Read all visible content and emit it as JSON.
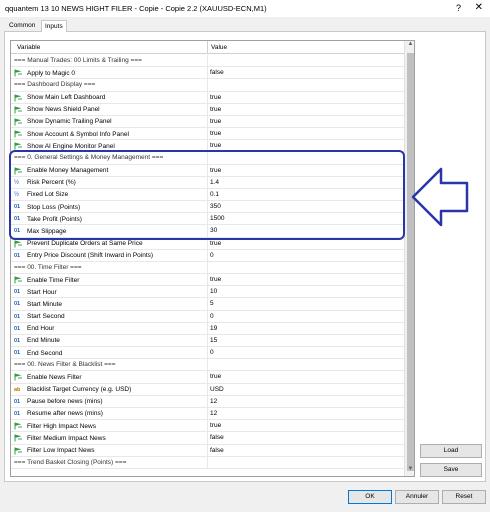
{
  "window": {
    "title": "qquantem 13 10 NEWS HIGHT FILER - Copie - Copie 2.2 (XAUUSD-ECN,M1)",
    "help": "?",
    "close": "✕"
  },
  "tabs": [
    {
      "label": "Common"
    },
    {
      "label": "Inputs"
    }
  ],
  "grid": {
    "col_variable": "Variable",
    "col_value": "Value",
    "rows": [
      {
        "icon": "",
        "name": "=== Manual Trades: 00 Limits & Trailing ===",
        "value": ""
      },
      {
        "icon": "flag",
        "name": "Apply to Magic 0",
        "value": "false"
      },
      {
        "icon": "",
        "name": "=== Dashboard Display ===",
        "value": ""
      },
      {
        "icon": "flag",
        "name": "Show Main Left Dashboard",
        "value": "true"
      },
      {
        "icon": "flag",
        "name": "Show News Shield Panel",
        "value": "true"
      },
      {
        "icon": "flag",
        "name": "Show Dynamic Trailing Panel",
        "value": "true"
      },
      {
        "icon": "flag",
        "name": "Show Account & Symbol Info Panel",
        "value": "true"
      },
      {
        "icon": "flag",
        "name": "Show AI Engine Monitor Panel",
        "value": "true"
      },
      {
        "icon": "",
        "name": "=== 0. General Settings & Money Management ===",
        "value": ""
      },
      {
        "icon": "flag",
        "name": "Enable Money Management",
        "value": "true"
      },
      {
        "icon": "frac",
        "name": "Risk Percent (%)",
        "value": "1.4"
      },
      {
        "icon": "frac",
        "name": "Fixed Lot Size",
        "value": "0.1"
      },
      {
        "icon": "num",
        "name": "Stop Loss (Points)",
        "value": "350"
      },
      {
        "icon": "num",
        "name": "Take Profit (Points)",
        "value": "1500"
      },
      {
        "icon": "num",
        "name": "Max Slippage",
        "value": "30"
      },
      {
        "icon": "flag",
        "name": "Prevent Duplicate Orders at Same Price",
        "value": "true"
      },
      {
        "icon": "num",
        "name": "Entry Price Discount (Shift Inward in Points)",
        "value": "0"
      },
      {
        "icon": "",
        "name": "=== 00. Time Filter ===",
        "value": ""
      },
      {
        "icon": "flag",
        "name": "Enable Time Filter",
        "value": "true"
      },
      {
        "icon": "num",
        "name": "Start Hour",
        "value": "10"
      },
      {
        "icon": "num",
        "name": "Start Minute",
        "value": "5"
      },
      {
        "icon": "num",
        "name": "Start Second",
        "value": "0"
      },
      {
        "icon": "num",
        "name": "End Hour",
        "value": "19"
      },
      {
        "icon": "num",
        "name": "End Minute",
        "value": "15"
      },
      {
        "icon": "num",
        "name": "End Second",
        "value": "0"
      },
      {
        "icon": "",
        "name": "=== 00. News Filter & Blacklist ===",
        "value": ""
      },
      {
        "icon": "flag",
        "name": "Enable News Filter",
        "value": "true"
      },
      {
        "icon": "ab",
        "name": "Blacklist Target Currency (e.g. USD)",
        "value": "USD"
      },
      {
        "icon": "num",
        "name": "Pause before news (mins)",
        "value": "12"
      },
      {
        "icon": "num",
        "name": "Resume after news (mins)",
        "value": "12"
      },
      {
        "icon": "flag",
        "name": "Filter High Impact News",
        "value": "true"
      },
      {
        "icon": "flag",
        "name": "Filter Medium Impact News",
        "value": "false"
      },
      {
        "icon": "flag",
        "name": "Filter Low Impact News",
        "value": "false"
      },
      {
        "icon": "",
        "name": "=== Trend Basket Closing (Points) ===",
        "value": ""
      }
    ]
  },
  "side_buttons": {
    "load": "Load",
    "save": "Save"
  },
  "bottom_buttons": {
    "ok": "OK",
    "annuler": "Annuler",
    "reset": "Reset"
  },
  "icons": {
    "flag_color": "#2e9e3a",
    "num_color": "#1a5fb4",
    "highlight_color": "#2a36a8"
  }
}
